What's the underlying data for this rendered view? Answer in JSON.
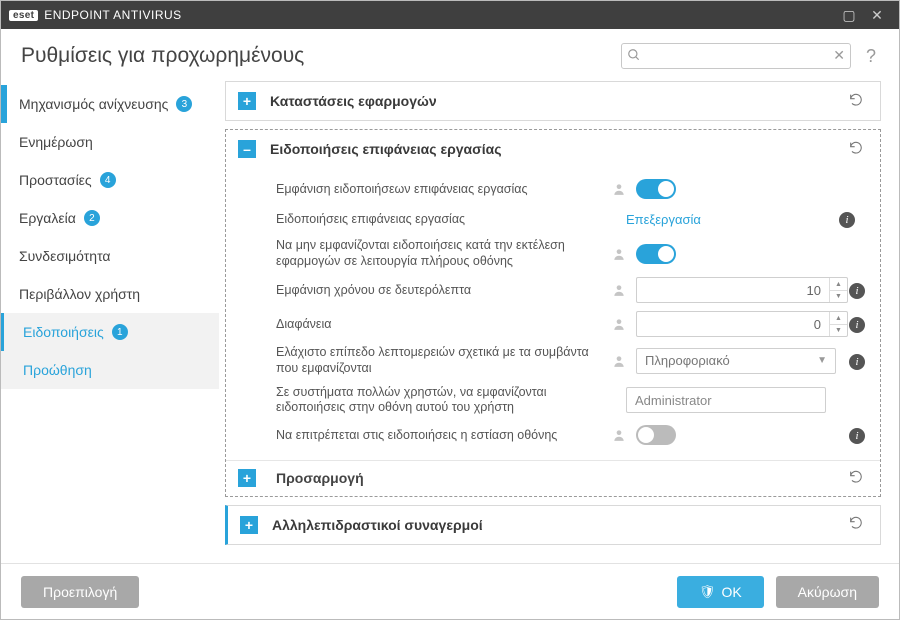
{
  "app": {
    "brand": "eset",
    "title": "ENDPOINT ANTIVIRUS"
  },
  "header": {
    "pagetitle": "Ρυθμίσεις για προχωρημένους",
    "search_placeholder": ""
  },
  "sidebar": {
    "items": [
      {
        "label": "Μηχανισμός ανίχνευσης",
        "badge": "3"
      },
      {
        "label": "Ενημέρωση"
      },
      {
        "label": "Προστασίες",
        "badge": "4"
      },
      {
        "label": "Εργαλεία",
        "badge": "2"
      },
      {
        "label": "Συνδεσιμότητα"
      },
      {
        "label": "Περιβάλλον χρήστη"
      },
      {
        "label": "Ειδοποιήσεις",
        "badge": "1"
      },
      {
        "label": "Προώθηση"
      }
    ]
  },
  "panels": {
    "app_states": "Καταστάσεις εφαρμογών",
    "desktop_notifications": "Ειδοποιήσεις επιφάνειας εργασίας",
    "customization": "Προσαρμογή",
    "interactive_alerts": "Αλληλεπιδραστικοί συναγερμοί"
  },
  "settings": {
    "show_desktop": "Εμφάνιση ειδοποιήσεων επιφάνειας εργασίας",
    "desktop_link_label": "Ειδοποιήσεις επιφάνειας εργασίας",
    "desktop_link_action": "Επεξεργασία",
    "fullscreen": "Να μην εμφανίζονται ειδοποιήσεις κατά την εκτέλεση εφαρμογών σε λειτουργία πλήρους οθόνης",
    "seconds_label": "Εμφάνιση χρόνου σε δευτερόλεπτα",
    "seconds_value": "10",
    "transparency_label": "Διαφάνεια",
    "transparency_value": "0",
    "verbosity_label": "Ελάχιστο επίπεδο λεπτομερειών σχετικά με τα συμβάντα που εμφανίζονται",
    "verbosity_value": "Πληροφοριακό",
    "multiuser_label": "Σε συστήματα πολλών χρηστών, να εμφανίζονται ειδοποιήσεις στην οθόνη αυτού του χρήστη",
    "multiuser_value": "Administrator",
    "focus_label": "Να επιτρέπεται στις ειδοποιήσεις η εστίαση οθόνης"
  },
  "footer": {
    "default": "Προεπιλογή",
    "ok": "OK",
    "cancel": "Ακύρωση"
  }
}
